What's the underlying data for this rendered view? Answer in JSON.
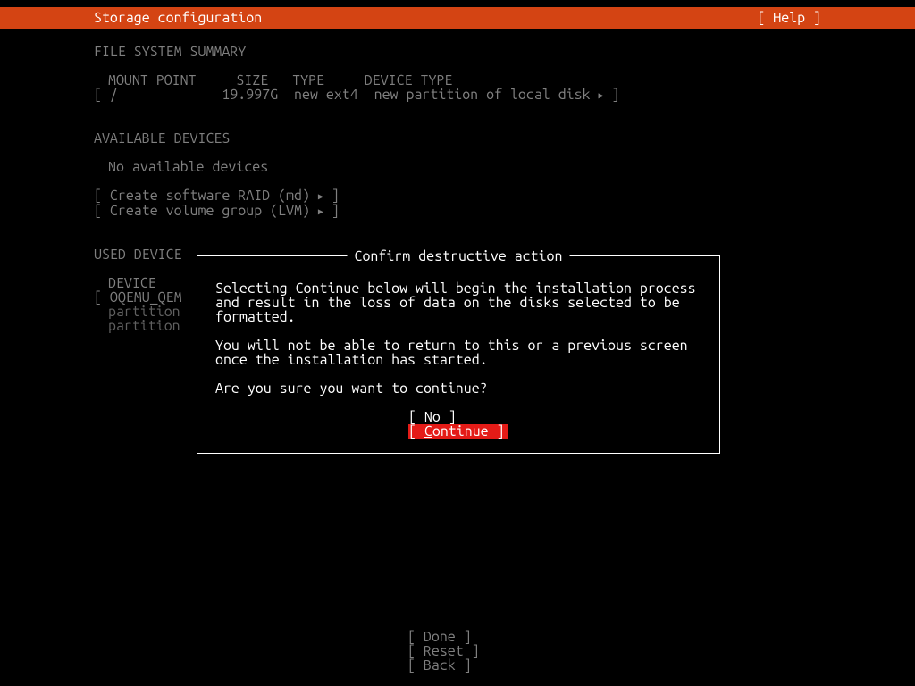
{
  "header": {
    "title": "Storage configuration",
    "help": "[ Help ]"
  },
  "fs_summary": {
    "title": "FILE SYSTEM SUMMARY",
    "headers": {
      "mount": "MOUNT POINT",
      "size": "SIZE",
      "type": "TYPE",
      "device_type": "DEVICE TYPE"
    },
    "row": {
      "mount": "/",
      "size": "19.997G",
      "type": "new ext4",
      "device_type": "new partition of local disk"
    }
  },
  "available": {
    "title": "AVAILABLE DEVICES",
    "none": "No available devices",
    "raid": "Create software RAID (md)",
    "lvm": "Create volume group (LVM)"
  },
  "used": {
    "title": "USED DEVICE",
    "headers": {
      "device": "DEVICE"
    },
    "rows": {
      "r0": "OQEMU_QEM",
      "r1": "partition",
      "r2": "partition"
    }
  },
  "dialog": {
    "title": " Confirm destructive action ",
    "p1": "Selecting Continue below will begin the installation process and result in the loss of data on the disks selected to be formatted.",
    "p2": "You will not be able to return to this or a previous screen once the installation has started.",
    "p3": "Are you sure you want to continue?",
    "no": "No",
    "continue": "ontinue"
  },
  "footer": {
    "done": "Done",
    "reset": "Reset",
    "back": "Back"
  }
}
